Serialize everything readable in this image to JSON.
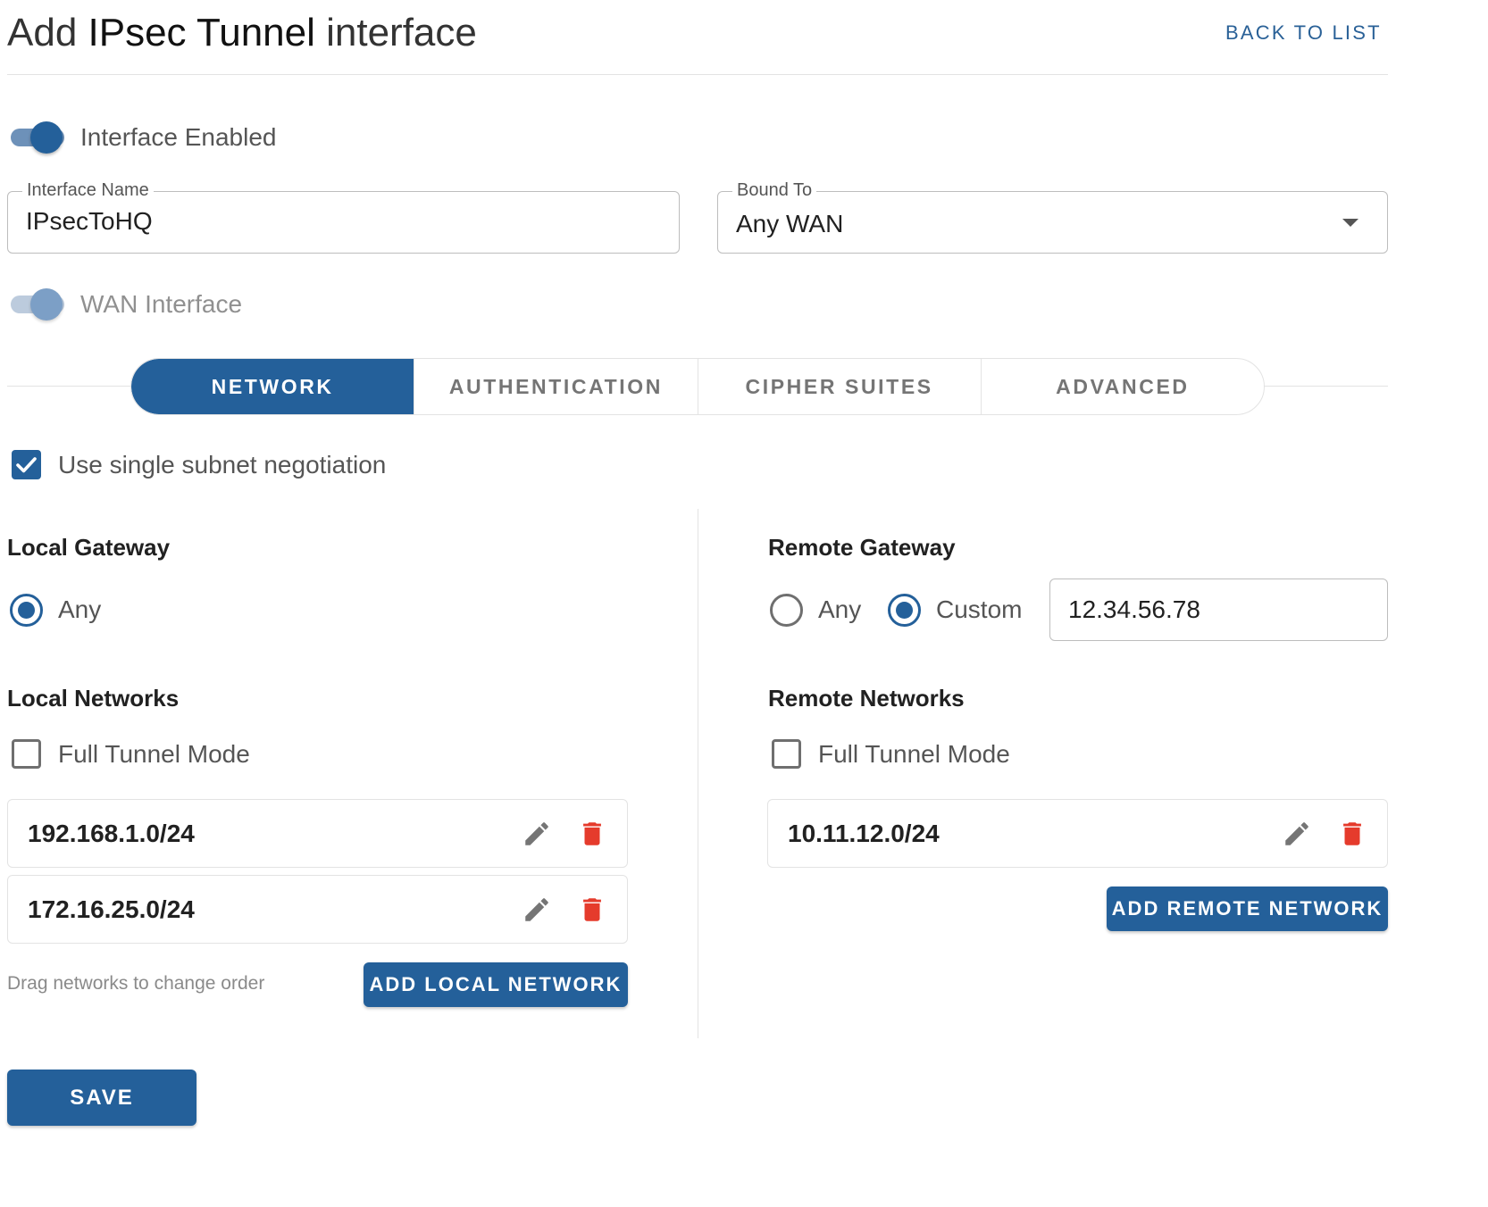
{
  "header": {
    "title_prefix": "Add ",
    "title_type": "IPsec Tunnel",
    "title_suffix": " interface",
    "back_link": "BACK TO LIST"
  },
  "interface_enabled": {
    "label": "Interface Enabled",
    "on": true
  },
  "interface_name": {
    "label": "Interface Name",
    "value": "IPsecToHQ"
  },
  "bound_to": {
    "label": "Bound To",
    "value": "Any WAN"
  },
  "wan_interface": {
    "label": "WAN Interface",
    "on": true,
    "disabled": true
  },
  "tabs": [
    {
      "label": "NETWORK",
      "active": true
    },
    {
      "label": "AUTHENTICATION",
      "active": false
    },
    {
      "label": "CIPHER SUITES",
      "active": false
    },
    {
      "label": "ADVANCED",
      "active": false
    }
  ],
  "single_subnet": {
    "label": "Use single subnet negotiation",
    "checked": true
  },
  "local_gateway": {
    "title": "Local Gateway",
    "options": [
      {
        "label": "Any",
        "selected": true
      }
    ]
  },
  "remote_gateway": {
    "title": "Remote Gateway",
    "options": [
      {
        "label": "Any",
        "selected": false
      },
      {
        "label": "Custom",
        "selected": true
      }
    ],
    "custom_value": "12.34.56.78"
  },
  "local_networks": {
    "title": "Local Networks",
    "full_tunnel_label": "Full Tunnel Mode",
    "full_tunnel_checked": false,
    "items": [
      "192.168.1.0/24",
      "172.16.25.0/24"
    ],
    "hint": "Drag networks to change order",
    "add_label": "ADD LOCAL NETWORK"
  },
  "remote_networks": {
    "title": "Remote Networks",
    "full_tunnel_label": "Full Tunnel Mode",
    "full_tunnel_checked": false,
    "items": [
      "10.11.12.0/24"
    ],
    "add_label": "ADD REMOTE NETWORK"
  },
  "save_label": "SAVE",
  "colors": {
    "primary": "#24609a",
    "delete": "#e53b2c",
    "edit": "#757575"
  },
  "icons": {
    "edit": "pencil-icon",
    "delete": "trash-icon",
    "dropdown": "caret-down-icon",
    "check": "checkmark-icon"
  }
}
